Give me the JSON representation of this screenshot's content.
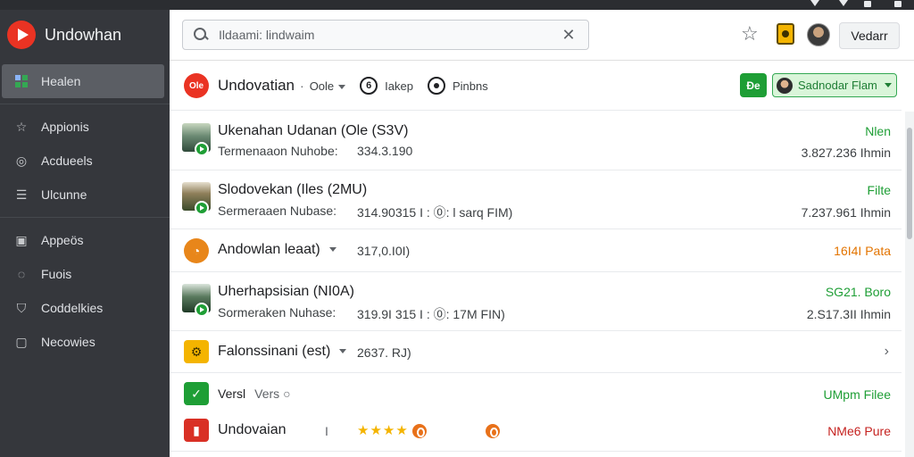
{
  "app": {
    "brand_name": "Undowhan"
  },
  "sidebar": {
    "items": [
      {
        "label": "Healen",
        "icon": "grid-icon",
        "active": true
      },
      {
        "label": "Appionis",
        "icon": "star-icon"
      },
      {
        "label": "Acdueels",
        "icon": "circle-icon"
      },
      {
        "label": "Ulcunne",
        "icon": "list-icon"
      },
      {
        "label": "Appeös",
        "icon": "box-icon"
      },
      {
        "label": "Fuois",
        "icon": "circle-icon"
      },
      {
        "label": "Coddelkies",
        "icon": "shield-icon"
      },
      {
        "label": "Necowies",
        "icon": "square-icon"
      }
    ]
  },
  "header": {
    "search_value": "Ildaami: lindwaim",
    "search_placeholder": "Search",
    "button_label": "Vedarr"
  },
  "subheader": {
    "logo_text": "Ole",
    "title": "Undovatian",
    "dropdown": "Oole",
    "chip1_icon": "6",
    "chip1_label": "Iakep",
    "chip2_label": "Pinbns",
    "green_box": "Ðe",
    "account_label": "Sadnodar Flam"
  },
  "rows": [
    {
      "title": "Ukenahan Udanan (Ole (S3V)",
      "sub": "Termenaaon Nuhobe:",
      "value": "334.3.190",
      "status": "Nlen",
      "meta": "3.827.236 Ihmin"
    },
    {
      "title": "Slodovekan (Iles (2MU)",
      "sub": "Sermeraaen Nubase:",
      "value": "314.90315 I :  ⓪: l sarq FIM)",
      "status": "Filte",
      "meta": "7.237.961 Ihmin"
    },
    {
      "title": "Andowlan leaat)",
      "value": "317,0.I0I)",
      "status": "16I4I Pata"
    },
    {
      "title": "Uherhapsisian (NI0A)",
      "sub": "Sormeraken Nuhase:",
      "value": "319.9I 315 I :  ⓪: 17M FIN)",
      "status": "SG21. Boro",
      "meta": "2.S17.3II Ihmin"
    },
    {
      "title": "Falonssinani (est)",
      "value": "2637. RJ)"
    },
    {
      "title": "Versl",
      "title2": "Vers",
      "status": "UMpm Filee"
    },
    {
      "title": "Undovaian",
      "divider": "I",
      "stars": "★★★★",
      "status": "NMe6 Pure"
    }
  ],
  "colors": {
    "sidebar": "#35373c",
    "accent_red": "#ea3323",
    "green": "#1e9e35",
    "orange": "#e37400"
  }
}
